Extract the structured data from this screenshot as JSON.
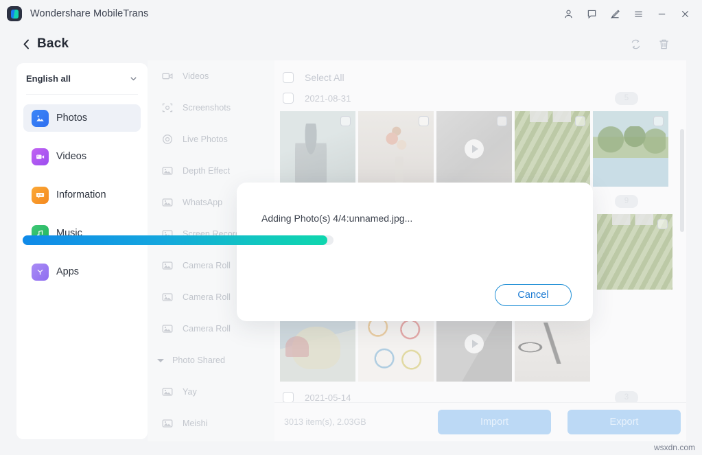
{
  "window": {
    "title": "Wondershare MobileTrans",
    "logo_icon": "mobiletrans-logo-icon",
    "controls": [
      {
        "name": "account-icon",
        "label": "Account"
      },
      {
        "name": "feedback-icon",
        "label": "Feedback"
      },
      {
        "name": "edit-pen-icon",
        "label": "Edit"
      },
      {
        "name": "menu-icon",
        "label": "Menu"
      },
      {
        "name": "minimize-icon",
        "label": "Minimize"
      },
      {
        "name": "close-icon",
        "label": "Close"
      }
    ]
  },
  "header": {
    "back_label": "Back",
    "back_icon": "chevron-left-icon",
    "tools": [
      {
        "name": "refresh-icon",
        "label": "Refresh"
      },
      {
        "name": "trash-icon",
        "label": "Delete"
      }
    ]
  },
  "sidebar": {
    "language_selector": {
      "label": "English all",
      "caret_icon": "chevron-down-icon"
    },
    "items": [
      {
        "label": "Photos",
        "icon": "photos-icon",
        "active": true
      },
      {
        "label": "Videos",
        "icon": "videos-icon",
        "active": false
      },
      {
        "label": "Information",
        "icon": "information-icon",
        "active": false
      },
      {
        "label": "Music",
        "icon": "music-icon",
        "active": false
      },
      {
        "label": "Apps",
        "icon": "apps-icon",
        "active": false
      }
    ]
  },
  "categories": [
    {
      "label": "Videos",
      "icon": "video-camera-icon",
      "type": "item"
    },
    {
      "label": "Screenshots",
      "icon": "screenshot-icon",
      "type": "item"
    },
    {
      "label": "Live Photos",
      "icon": "live-photo-icon",
      "type": "item"
    },
    {
      "label": "Depth Effect",
      "icon": "photo-icon",
      "type": "item"
    },
    {
      "label": "WhatsApp",
      "icon": "photo-icon",
      "type": "item"
    },
    {
      "label": "Screen Recorder",
      "icon": "photo-icon",
      "type": "item"
    },
    {
      "label": "Camera Roll",
      "icon": "photo-icon",
      "type": "item"
    },
    {
      "label": "Camera Roll",
      "icon": "photo-icon",
      "type": "item"
    },
    {
      "label": "Camera Roll",
      "icon": "photo-icon",
      "type": "item"
    },
    {
      "label": "Photo Shared",
      "icon": "triangle-collapse-icon",
      "type": "group"
    },
    {
      "label": "Yay",
      "icon": "photo-icon",
      "type": "item"
    },
    {
      "label": "Meishi",
      "icon": "photo-icon",
      "type": "item"
    }
  ],
  "content": {
    "select_all_label": "Select All",
    "date_groups": [
      {
        "date": "2021-08-31",
        "count": "5"
      },
      {
        "date": "",
        "count": "9"
      },
      {
        "date": "2021-05-14",
        "count": "3"
      }
    ],
    "rows": [
      [
        {
          "art": "a1",
          "kind": "photo",
          "alt": "person-photo"
        },
        {
          "art": "a2",
          "kind": "photo",
          "alt": "flower-vase-photo"
        },
        {
          "art": "a3",
          "kind": "video",
          "alt": "video-thumbnail"
        },
        {
          "art": "a4",
          "kind": "photo",
          "alt": "green-foliage-photo"
        },
        {
          "art": "a5",
          "kind": "photo",
          "alt": "palm-beach-photo"
        }
      ],
      [
        {
          "art": "a4",
          "kind": "photo",
          "alt": "green-foliage-photo"
        }
      ],
      [
        {
          "art": "a6",
          "kind": "photo",
          "alt": "illustration-photo"
        },
        {
          "art": "a7",
          "kind": "photo",
          "alt": "infographic-photo"
        },
        {
          "art": "a8",
          "kind": "video",
          "alt": "video-thumbnail"
        },
        {
          "art": "a9",
          "kind": "photo",
          "alt": "cables-photo"
        }
      ]
    ],
    "status_text": "3013 item(s), 2.03GB",
    "import_label": "Import",
    "export_label": "Export"
  },
  "modal": {
    "message": "Adding Photo(s) 4/4:unnamed.jpg...",
    "progress_percent": 98,
    "cancel_label": "Cancel"
  },
  "watermark": "wsxdn.com",
  "colors": {
    "accent_blue": "#1878d2",
    "progress_start": "#108ae8",
    "progress_end": "#0fd6ae",
    "button_disabled": "#bcd9f5",
    "sidebar_active": "#eef1f7"
  }
}
